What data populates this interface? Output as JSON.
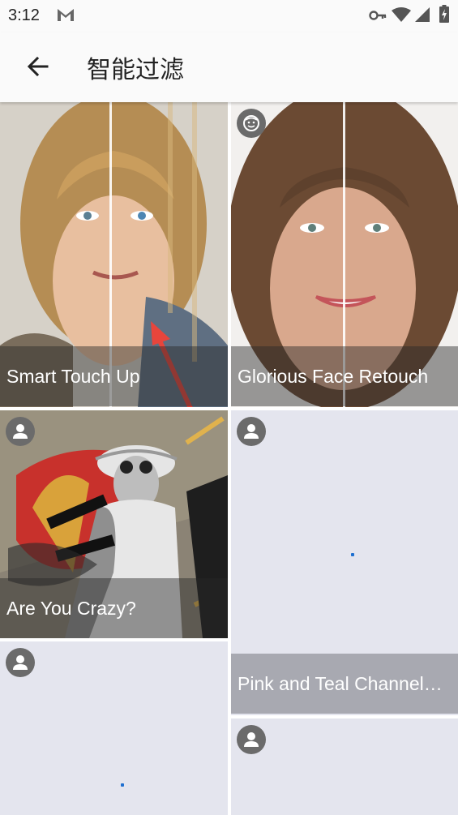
{
  "status_bar": {
    "time": "3:12",
    "icons": [
      "gmail-icon",
      "key-icon",
      "wifi-icon",
      "signal-icon",
      "battery-icon"
    ]
  },
  "app_bar": {
    "title": "智能过滤",
    "back_icon": "arrow-left-icon"
  },
  "filters": [
    {
      "name": "Smart Touch Up",
      "badge_icon": null,
      "state": "image-loaded",
      "colors": {
        "bg": "#a88e6a"
      }
    },
    {
      "name": "Glorious Face Retouch",
      "badge_icon": "face-icon",
      "state": "image-loaded",
      "colors": {
        "bg": "#8a6a52"
      }
    },
    {
      "name": "Are You Crazy?",
      "badge_icon": "person-icon",
      "state": "image-loaded",
      "colors": {
        "bg": "#7b7263"
      }
    },
    {
      "name": "Pink and Teal Channel…",
      "badge_icon": "person-icon",
      "state": "loading"
    },
    {
      "name": "",
      "badge_icon": "person-icon",
      "state": "loading"
    },
    {
      "name": "",
      "badge_icon": "person-icon",
      "state": "loading"
    }
  ],
  "colors": {
    "caption_overlay": "rgba(40,40,40,0.45)",
    "caption_overlay_solid": "#a8a9b1",
    "tile_placeholder": "#e4e5ee",
    "annotation_arrow": "#e8453c"
  }
}
